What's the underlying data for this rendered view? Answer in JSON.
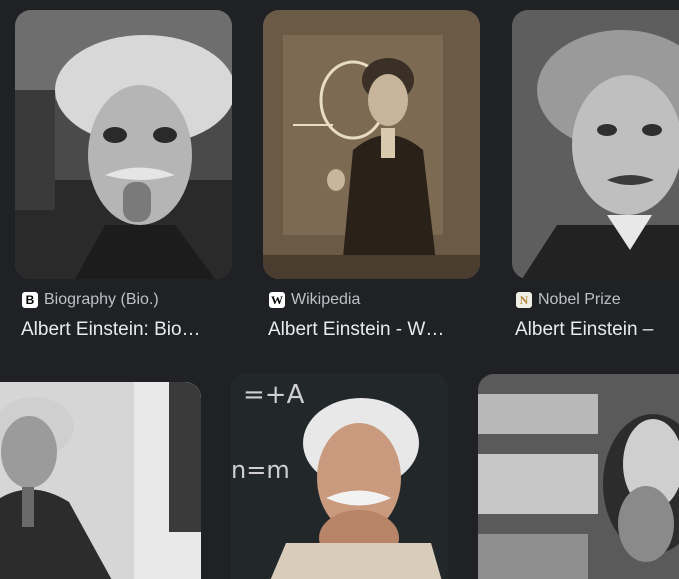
{
  "results": [
    {
      "source": "Biography (Bio.)",
      "favicon_glyph": "B",
      "favicon_icon": "biography-favicon-icon",
      "title": "Albert Einstein: Bio…",
      "image_subject": "einstein-tongue-photo"
    },
    {
      "source": "Wikipedia",
      "favicon_glyph": "W",
      "favicon_icon": "wikipedia-favicon-icon",
      "title": "Albert Einstein - W…",
      "image_subject": "einstein-blackboard-photo"
    },
    {
      "source": "Nobel Prize",
      "favicon_glyph": "N",
      "favicon_icon": "nobel-prize-favicon-icon",
      "title": "Albert Einstein –",
      "image_subject": "einstein-portrait-photo"
    },
    {
      "image_subject": "einstein-standing-photo"
    },
    {
      "image_subject": "einstein-chalkboard-equation-photo"
    },
    {
      "image_subject": "einstein-bookshelf-photo"
    }
  ],
  "colors": {
    "background": "#202124",
    "source_text": "#bdc1c6",
    "title_text": "#e8eaed"
  }
}
